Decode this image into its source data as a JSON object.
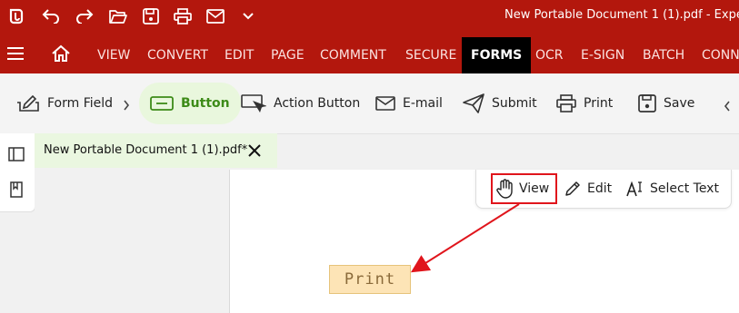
{
  "window": {
    "title": "New Portable Document 1 (1).pdf  -  Expe"
  },
  "quick_access": [
    "app-logo-icon",
    "undo-icon",
    "redo-icon",
    "open-folder-icon",
    "save-icon",
    "print-icon",
    "mail-icon",
    "chevron-down-icon"
  ],
  "menu": {
    "items": [
      "VIEW",
      "CONVERT",
      "EDIT",
      "PAGE",
      "COMMENT",
      "SECURE",
      "FORMS",
      "OCR",
      "E-SIGN",
      "BATCH",
      "CONN"
    ],
    "active": "FORMS"
  },
  "ribbon": {
    "form_field": "Form Field",
    "button": "Button",
    "action_button": "Action Button",
    "email": "E-mail",
    "submit": "Submit",
    "print": "Print",
    "save": "Save"
  },
  "tab": {
    "label": "New Portable Document 1 (1).pdf*"
  },
  "modes": {
    "view": "View",
    "edit": "Edit",
    "select_text": "Select Text",
    "selected": "View"
  },
  "document": {
    "button_label": "Print"
  },
  "colors": {
    "brand": "#b3170d",
    "active_tab": "#000000",
    "highlight": "#e0151c",
    "form_button_fill": "#fde4b6",
    "ribbon_active": "#3d8b18"
  }
}
